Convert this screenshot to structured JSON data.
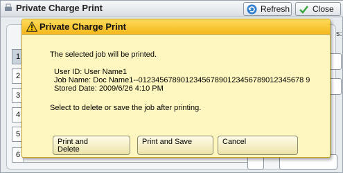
{
  "background": {
    "title": "Private Charge Print",
    "refresh_label": "Refresh",
    "close_label": "Close",
    "side_text": "s:",
    "row_numbers": [
      "1",
      "2",
      "3",
      "4",
      "5",
      "6"
    ]
  },
  "dialog": {
    "title": "Private Charge Print",
    "message": "The selected job will be printed.",
    "user_id": "User ID: User Name1",
    "job_name": "Job Name: Doc Name1--012345678901234567890123456789012345678 9",
    "stored_date": "Stored Date: 2009/6/26 4:10 PM",
    "instruction": "Select to delete or save the job after printing.",
    "buttons": {
      "print_delete_line1": "Print and",
      "print_delete_line2": "Delete",
      "print_save": "Print and Save",
      "cancel": "Cancel"
    }
  },
  "colors": {
    "dialog_bg": "#fff7bf",
    "header_accent": "#f3b81c"
  }
}
